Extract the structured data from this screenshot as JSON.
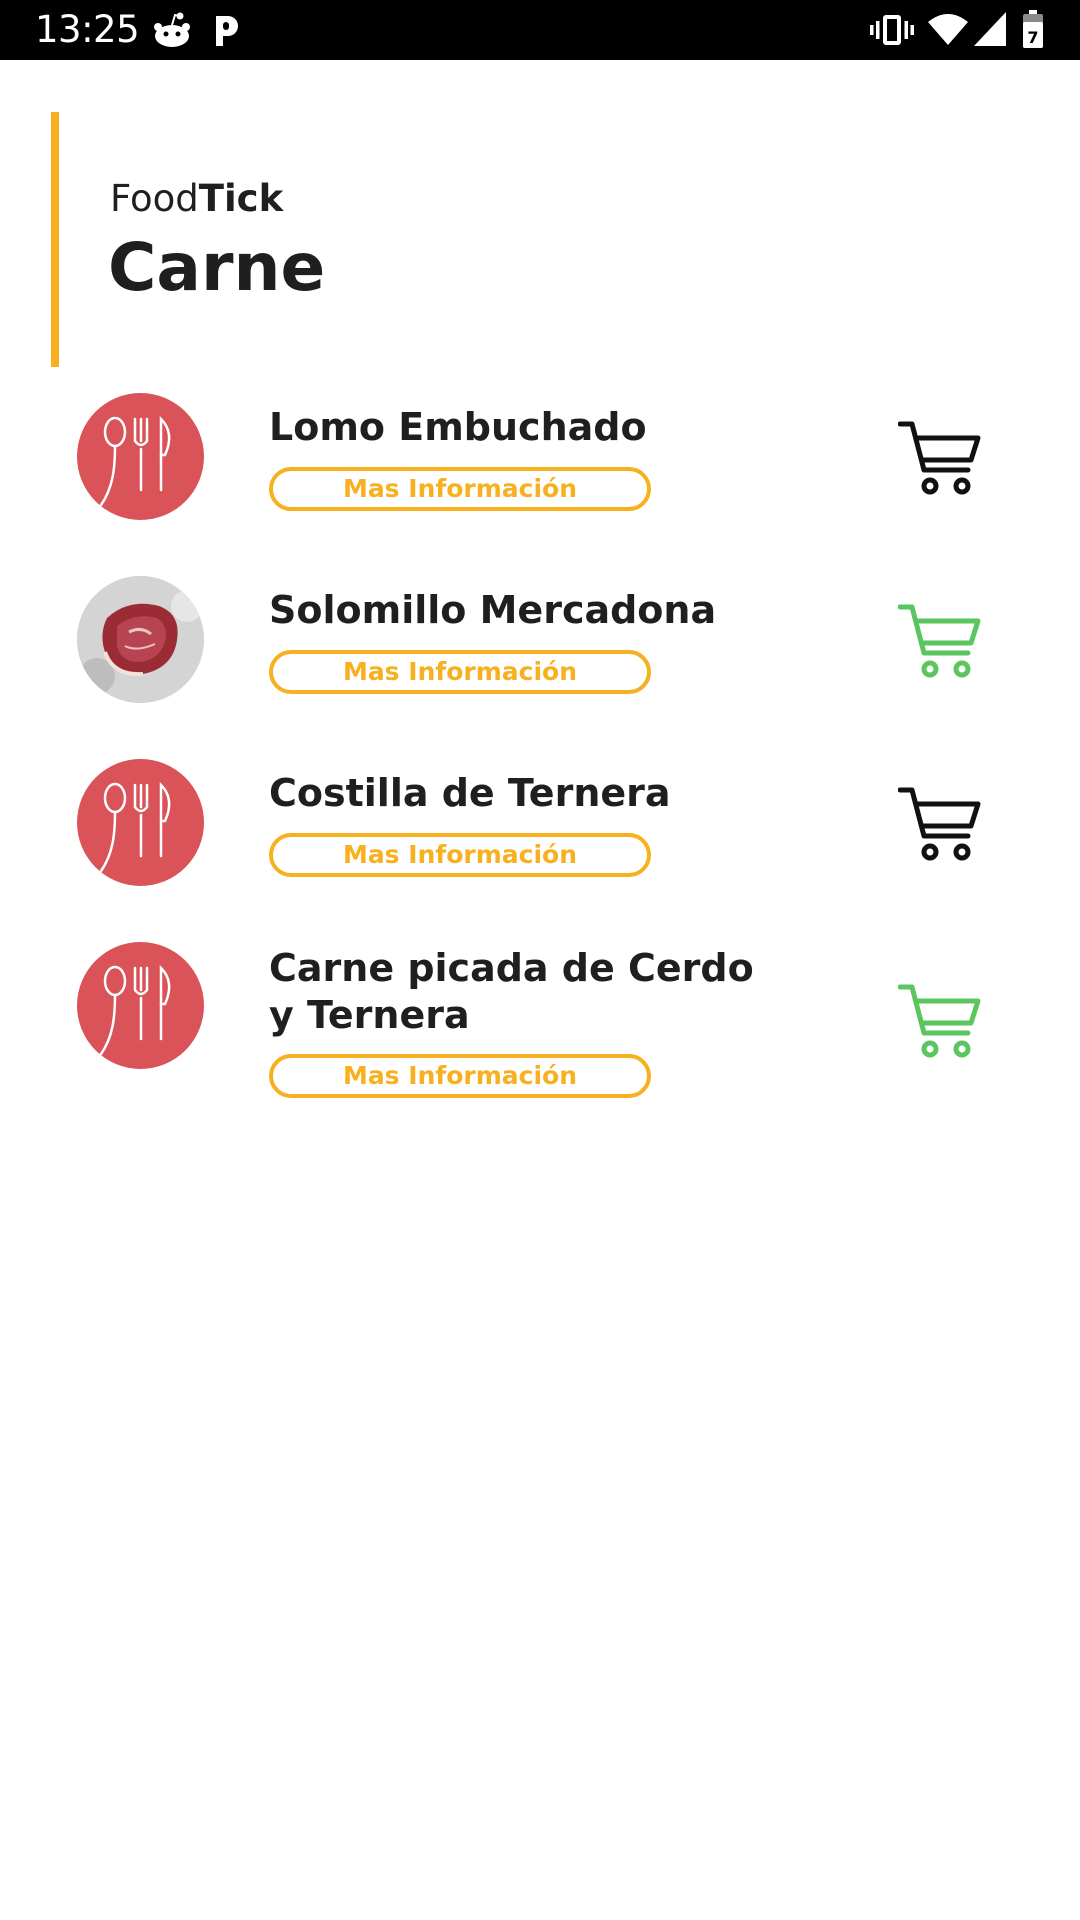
{
  "status_bar": {
    "time": "13:25",
    "icons": [
      "reddit-icon",
      "p-app-icon",
      "vibrate-icon",
      "wifi-icon",
      "signal-icon",
      "battery-icon"
    ],
    "battery_level": "7"
  },
  "header": {
    "brand_light": "Food",
    "brand_bold": "Tick",
    "title": "Carne"
  },
  "colors": {
    "accent": "#F7B01F",
    "placeholder_red": "#D95358",
    "cart_default": "#111111",
    "cart_added": "#5BC65F"
  },
  "products": [
    {
      "name": "Lomo Embuchado",
      "info_label": "Mas Información",
      "image": "placeholder-utensils",
      "cart_state": "default"
    },
    {
      "name": "Solomillo Mercadona",
      "info_label": "Mas Información",
      "image": "meat-photo",
      "cart_state": "added"
    },
    {
      "name": "Costilla de Ternera",
      "info_label": "Mas Información",
      "image": "placeholder-utensils",
      "cart_state": "default"
    },
    {
      "name": "Carne picada de Cerdo y Ternera",
      "info_label": "Mas Información",
      "image": "placeholder-utensils",
      "cart_state": "added"
    }
  ]
}
